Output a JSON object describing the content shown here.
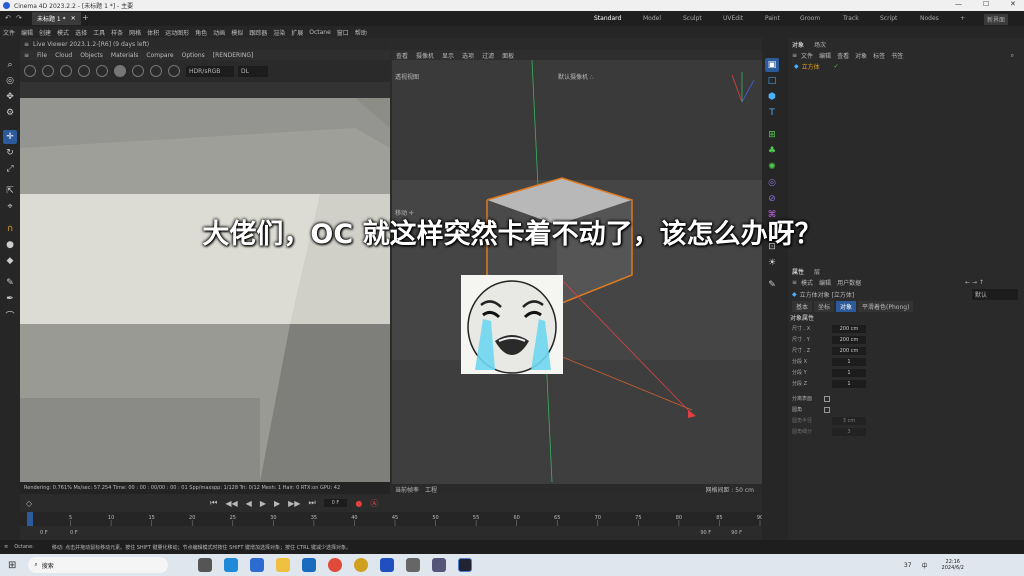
{
  "window": {
    "title": "Cinema 4D 2023.2.2 - [未标题 1 *] - 主要",
    "minimize": "—",
    "maximize": "☐",
    "close": "✕"
  },
  "tabs": {
    "doc": "未标题 1 *",
    "add": "+"
  },
  "layouts": [
    "Standard",
    "Model",
    "Sculpt",
    "UVEdit",
    "Paint",
    "Groom",
    "Track",
    "Script",
    "Nodes"
  ],
  "layout_add": "+",
  "new_layout": "新界面",
  "menu": [
    "文件",
    "编辑",
    "创建",
    "模式",
    "选择",
    "工具",
    "样条",
    "网格",
    "体积",
    "运动图形",
    "角色",
    "动画",
    "模拟",
    "跟踪器",
    "渲染",
    "扩展",
    "Octane",
    "窗口",
    "帮助"
  ],
  "axis_labels": [
    "X",
    "Y",
    "Z"
  ],
  "live_viewer": {
    "title": "Live Viewer 2023.1.2-[R6] (9 days left)",
    "menu": [
      "File",
      "Cloud",
      "Objects",
      "Materials",
      "Compare",
      "Options",
      "[RENDERING]"
    ],
    "color_space": "HDR/sRGB",
    "mode": "DL",
    "status": "Rendering: 0.761%  Ms/sec: 57.254  Time: 00 : 00 : 00/00 : 00 : 01  Spp/maxspp: 1/128  Tri: 0/12  Mesh: 1  Hair: 0  RTX:on  GPU:  42"
  },
  "viewport": {
    "menu": [
      "查看",
      "摄像机",
      "显示",
      "选项",
      "过滤",
      "面板"
    ],
    "name": "透视视图",
    "camera": "默认摄像机 ∴",
    "move_label": "移动 ✛",
    "footer_left": "当前帧率",
    "footer_work": "工程",
    "grid": "网格间距 : 50 cm"
  },
  "objects_panel": {
    "tabs": [
      "对象",
      "场次"
    ],
    "menu": [
      "文件",
      "编辑",
      "查看",
      "对象",
      "标签",
      "书签"
    ],
    "object_name": "立方体"
  },
  "attributes_panel": {
    "tabs": [
      "属性",
      "层"
    ],
    "menu": [
      "模式",
      "编辑",
      "用户数据"
    ],
    "object_title": "立方体对象 [立方体]",
    "preset": "默认",
    "subtabs": [
      "基本",
      "坐标",
      "对象",
      "平滑着色(Phong)"
    ],
    "section": "对象属性",
    "props": [
      {
        "label": "尺寸 . X",
        "value": "200 cm"
      },
      {
        "label": "尺寸 . Y",
        "value": "200 cm"
      },
      {
        "label": "尺寸 . Z",
        "value": "200 cm"
      },
      {
        "label": "分段 X",
        "value": "1"
      },
      {
        "label": "分段 Y",
        "value": "1"
      },
      {
        "label": "分段 Z",
        "value": "1"
      }
    ],
    "separate_surfaces": "分离表面",
    "fillet": "圆角",
    "fillet_radius_label": "圆角半径",
    "fillet_radius_value": "3 cm",
    "fillet_sub_label": "圆角细分",
    "fillet_sub_value": "3"
  },
  "timeline": {
    "current_frame": "0 F",
    "ticks": [
      "0",
      "5",
      "10",
      "15",
      "20",
      "25",
      "30",
      "35",
      "40",
      "45",
      "50",
      "55",
      "60",
      "65",
      "70",
      "75",
      "80",
      "85",
      "90"
    ],
    "start": "0 F",
    "min": "0 F",
    "max": "90 F",
    "end": "90 F"
  },
  "status": {
    "app": "Octane:",
    "hint": "移动: 点击并拖动鼠标移动元素。按住 SHIFT 键量化移动；节点编辑模式时按住 SHIFT 键增加选择对象；按住 CTRL 键减少选择对象。"
  },
  "taskbar": {
    "search": "搜索",
    "temp": "37",
    "time": "22:16",
    "date": "2024/6/2",
    "lang": "中"
  },
  "overlay_text": "大佬们，OC 就这样突然卡着不动了，该怎么办呀？"
}
